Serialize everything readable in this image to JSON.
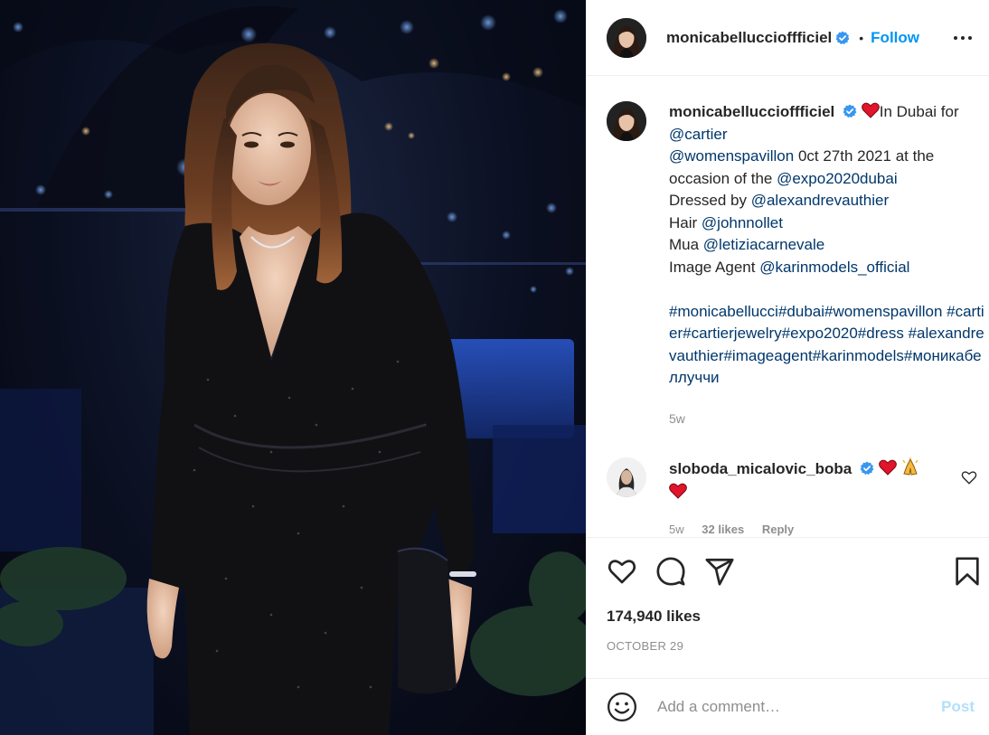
{
  "post": {
    "image_alt": "",
    "author": "monicabelluccioffficiel",
    "author_display": "monicabelluccioffficiel",
    "follow_label": "Follow",
    "more_icon": "more-options-icon",
    "verified_icon": "verified-badge-icon"
  },
  "header": {
    "username": "monicabelluccioffficiel",
    "dot": "•",
    "follow": "Follow"
  },
  "caption": {
    "username": "monicabelluccioffficiel",
    "emoji": "heart-emoji",
    "lines": {
      "l1_text": "In Dubai for",
      "l2_link": "@cartier",
      "l3_link": "@womenspavillon",
      "l3_text": " 0ct 27th 2021 at the occasion of the ",
      "l3_link2": "@expo2020dubai",
      "l4_text": "Dressed by ",
      "l4_link": "@alexandrevauthier",
      "l5_text": "Hair ",
      "l5_link": "@johnnollet",
      "l6_text": "Mua ",
      "l6_link": "@letiziacarnevale",
      "l7_text": "Image Agent ",
      "l7_link": "@karinmodels_official"
    },
    "hashtags": "#monicabellucci#dubai#womenspavillon #cartier#cartierjewelry#expo2020#dress #alexandrevauthier#imageagent#karinmodels#моникабеллуччи",
    "time": "5w"
  },
  "comment": {
    "username": "sloboda_micalovic_boba",
    "time": "5w",
    "likes": "32 likes",
    "reply": "Reply"
  },
  "actions": {
    "like_icon": "heart-outline-icon",
    "comment_icon": "comment-icon",
    "share_icon": "share-icon",
    "save_icon": "bookmark-icon"
  },
  "stats": {
    "likes": "174,940 likes",
    "date": "OCTOBER 29"
  },
  "add_comment": {
    "placeholder": "Add a comment…",
    "post_label": "Post"
  },
  "colors": {
    "link": "#00376b",
    "accent": "#0095f6",
    "heart": "#ed4956",
    "muted": "#8e8e8e"
  }
}
